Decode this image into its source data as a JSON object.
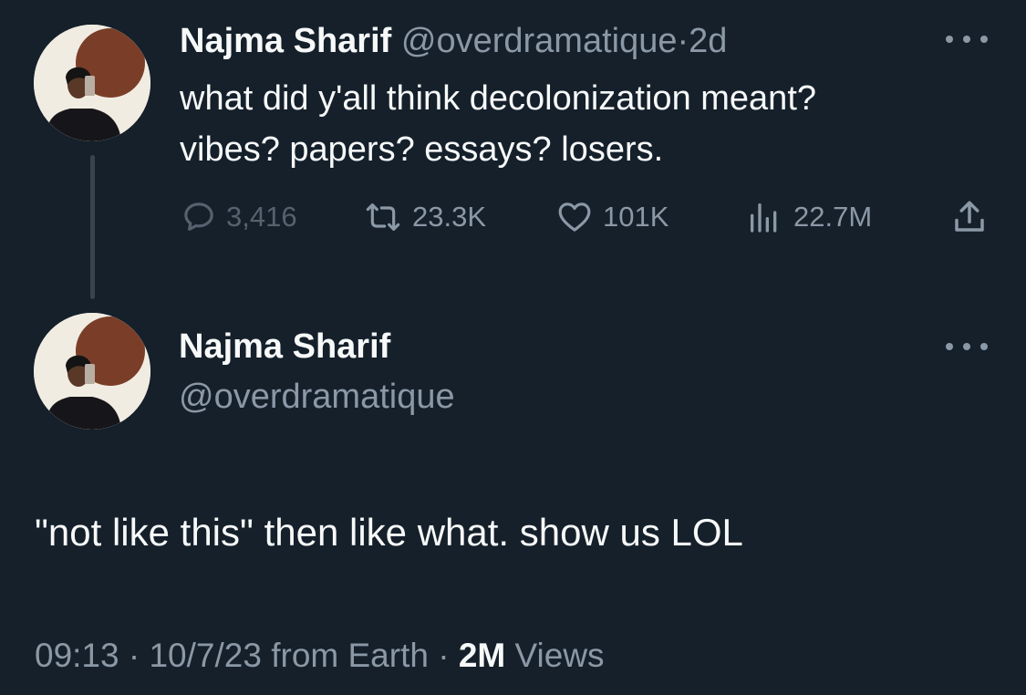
{
  "tweet1": {
    "name": "Najma Sharif",
    "handle": "@overdramatique",
    "separator": "·",
    "age": "2d",
    "text": "what did y'all think decolonization meant?\nvibes? papers? essays? losers.",
    "stats": {
      "replies": "3,416",
      "reposts": "23.3K",
      "likes": "101K",
      "views": "22.7M"
    }
  },
  "tweet2": {
    "name": "Najma Sharif",
    "handle": "@overdramatique",
    "text": "\"not like this\" then like what. show us LOL",
    "meta": {
      "time": "09:13",
      "separator": "·",
      "date": "10/7/23",
      "source": "from Earth",
      "views_count": "2M",
      "views_label": "Views"
    }
  },
  "icons": {
    "reply": "speech-bubble-icon",
    "repost": "repost-arrows-icon",
    "like": "heart-icon",
    "views": "bar-chart-icon",
    "share": "share-upload-icon",
    "more": "ellipsis-icon"
  },
  "colors": {
    "background": "#15202b",
    "primary_text": "#f7f9f9",
    "secondary_text": "#8b98a5",
    "thread_line": "#38444d"
  }
}
